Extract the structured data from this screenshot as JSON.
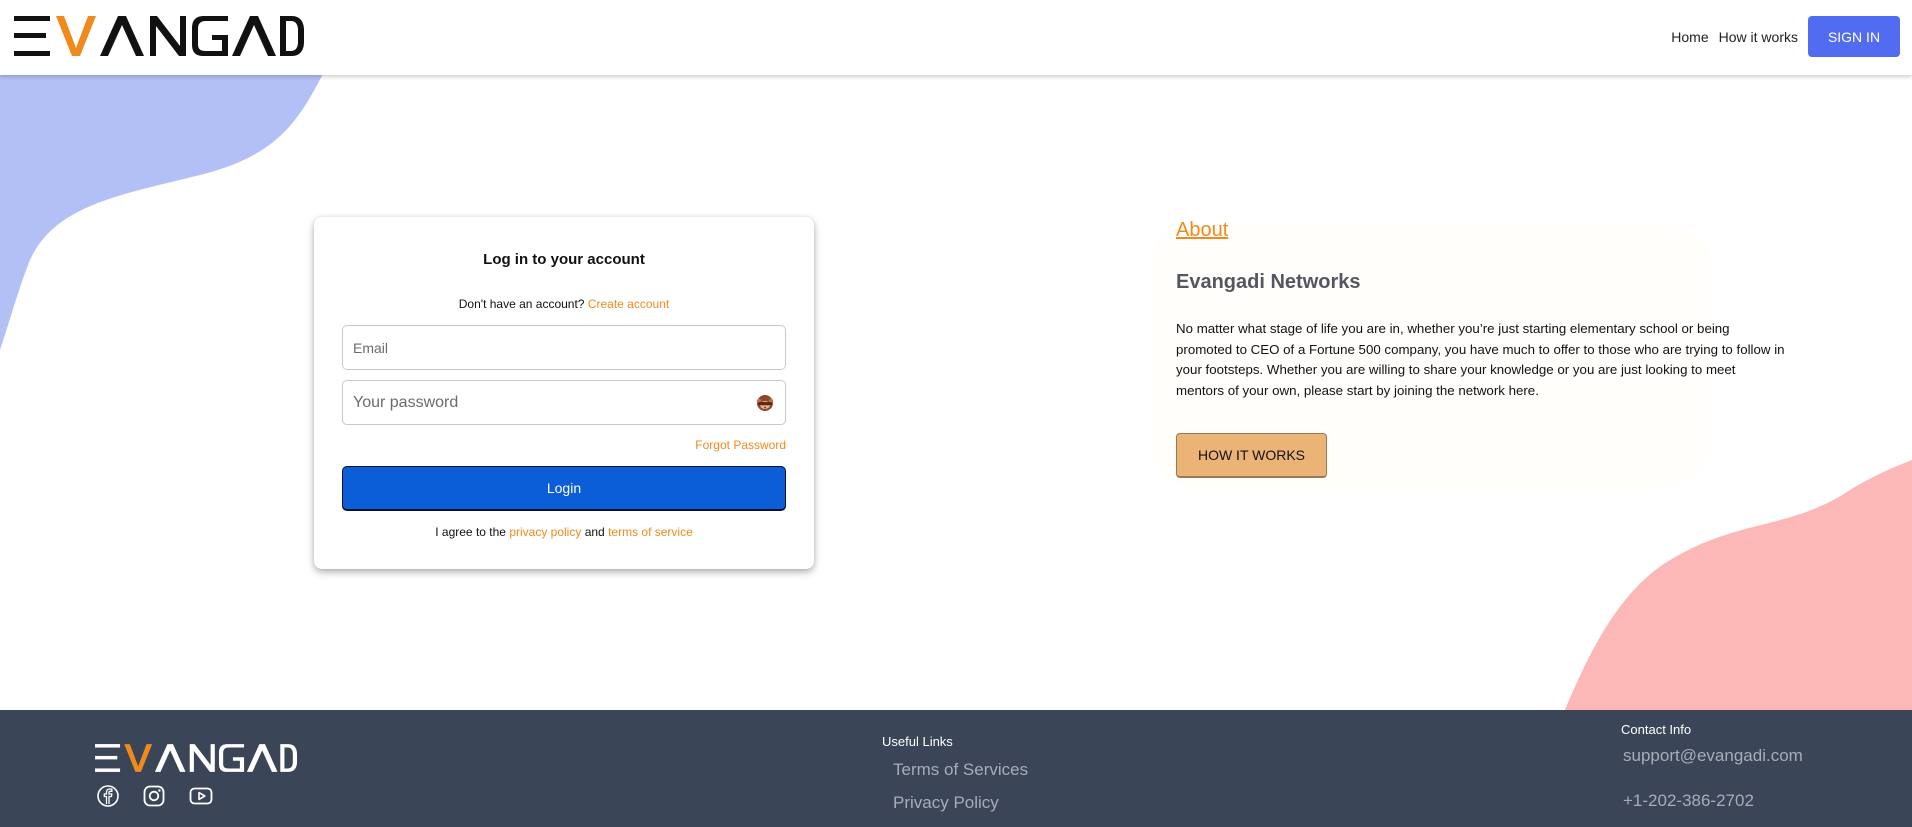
{
  "header": {
    "brand": "EVANGADI",
    "nav": {
      "home": "Home",
      "how_it_works": "How it works"
    },
    "sign_in": "SIGN IN"
  },
  "login": {
    "title": "Log in to your account",
    "no_account_text": "Don't have an account?",
    "create_account": "Create account",
    "email_placeholder": "Email",
    "password_placeholder": "Your password",
    "forgot_password": "Forgot Password",
    "login_button": "Login",
    "agree_prefix": "I agree to the",
    "privacy_policy": "privacy policy",
    "and": "and",
    "terms_of_service": "terms of service"
  },
  "about": {
    "link": "About",
    "heading": "Evangadi Networks",
    "text": "No matter what stage of life you are in, whether you’re just starting elementary school or being promoted to CEO of a Fortune 500 company, you have much to offer to those who are trying to follow in your footsteps. Whether you are willing to share your knowledge or you are just looking to meet mentors of your own, please start by joining the network here.",
    "button": "HOW IT WORKS"
  },
  "footer": {
    "brand": "EVANGADI",
    "socials": [
      "facebook-icon",
      "instagram-icon",
      "youtube-icon"
    ],
    "useful_links": {
      "title": "Useful Links",
      "items": [
        "Terms of Services",
        "Privacy Policy"
      ]
    },
    "contact": {
      "title": "Contact Info",
      "email": "support@evangadi.com",
      "phone": "+1-202-386-2702"
    }
  },
  "colors": {
    "accent_orange": "#f08a1c",
    "sign_in_blue": "#516cf0",
    "login_blue": "#0b5ed7",
    "how_button": "#ebb476",
    "footer_bg": "#3a4558",
    "blob_blue": "#b3c0f5",
    "blob_pink": "#fbb8b6"
  }
}
